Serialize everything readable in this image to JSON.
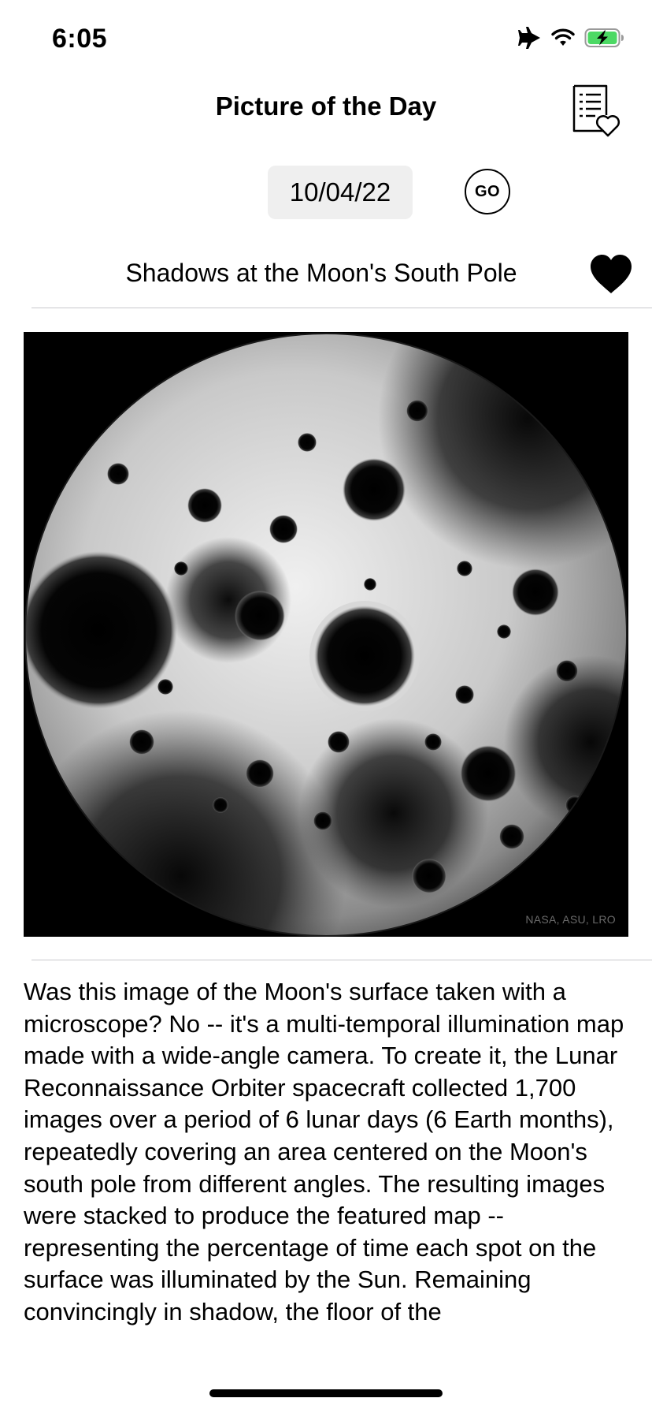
{
  "status_bar": {
    "time": "6:05",
    "icons": [
      "airplane-mode-icon",
      "wifi-icon",
      "battery-charging-icon"
    ]
  },
  "nav": {
    "title": "Picture of the Day",
    "favorites_icon": "favorites-list-icon"
  },
  "date_picker": {
    "value": "10/04/22",
    "go_label": "GO"
  },
  "picture": {
    "title": "Shadows at the Moon's South Pole",
    "favorite_icon": "heart-filled-icon",
    "favorited": true,
    "image_credit": "NASA, ASU, LRO",
    "description": "Was this image of the Moon's surface taken with a microscope? No -- it's a multi-temporal illumination map made with a wide-angle camera. To create it, the Lunar Reconnaissance Orbiter spacecraft collected 1,700 images over a period of 6 lunar days (6 Earth months), repeatedly covering an area centered on the Moon's south pole from different angles.  The resulting images were stacked to produce the featured map -- representing the percentage of time each spot on the surface was illuminated by the Sun. Remaining convincingly in shadow, the floor of the"
  },
  "colors": {
    "date_field_bg": "#efefef",
    "divider": "#c8c8cc",
    "battery_green": "#4cd964"
  }
}
